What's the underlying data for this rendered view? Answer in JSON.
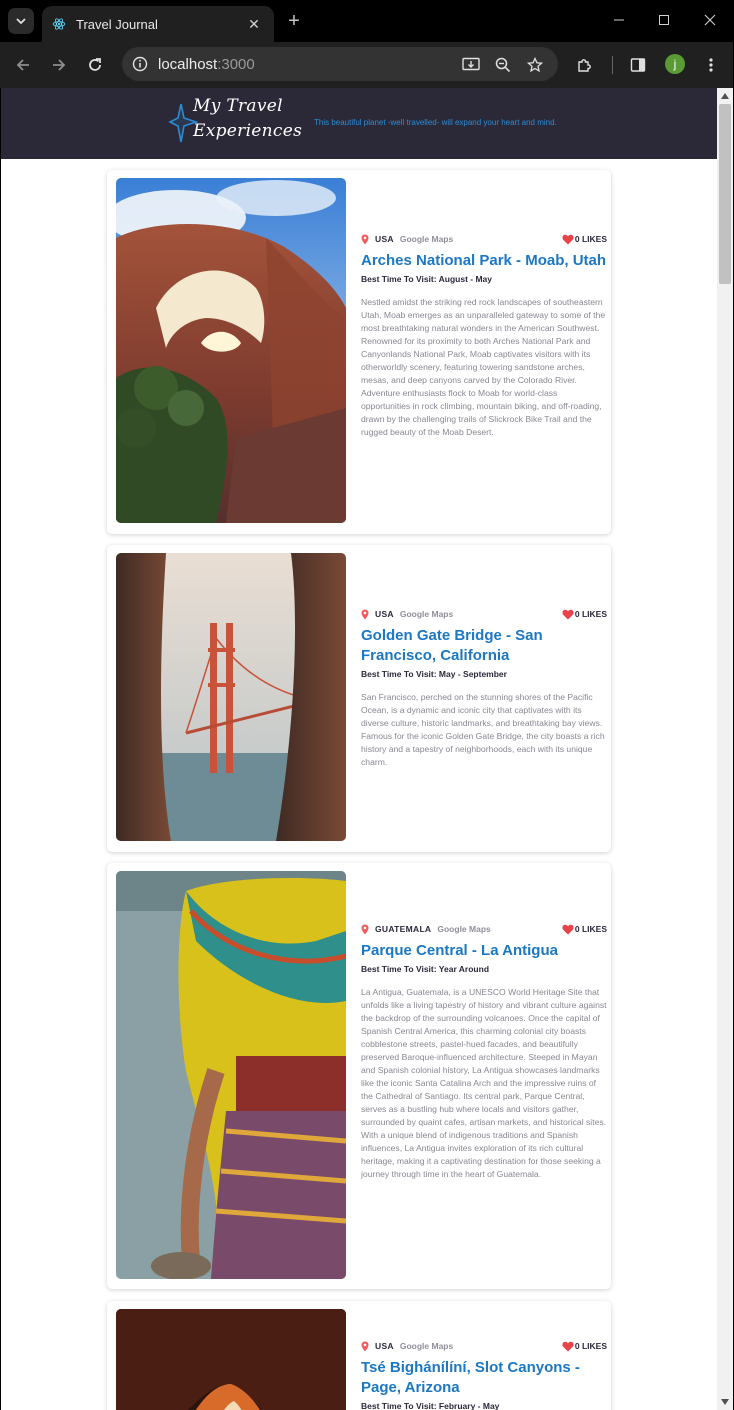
{
  "browser": {
    "tab_title": "Travel Journal",
    "url_host": "localhost",
    "url_port": ":3000",
    "profile_initial": "j"
  },
  "header": {
    "title_line1": "My Travel",
    "title_line2": "Experiences",
    "tagline": "This beautiful planet -well travelled- will expand your heart and mind."
  },
  "cards": [
    {
      "country": "USA",
      "maps_label": "Google Maps",
      "likes": "0 LIKES",
      "title": "Arches National Park - Moab, Utah",
      "best_time": "Best Time To Visit: August - May",
      "description": "Nestled amidst the striking red rock landscapes of southeastern Utah, Moab emerges as an unparalleled gateway to some of the most breathtaking natural wonders in the American Southwest. Renowned for its proximity to both Arches National Park and Canyonlands National Park, Moab captivates visitors with its otherworldly scenery, featuring towering sandstone arches, mesas, and deep canyons carved by the Colorado River. Adventure enthusiasts flock to Moab for world-class opportunities in rock climbing, mountain biking, and off-roading, drawn by the challenging trails of Slickrock Bike Trail and the rugged beauty of the Moab Desert."
    },
    {
      "country": "USA",
      "maps_label": "Google Maps",
      "likes": "0 LIKES",
      "title": "Golden Gate Bridge - San Francisco, California",
      "best_time": "Best Time To Visit: May - September",
      "description": "San Francisco, perched on the stunning shores of the Pacific Ocean, is a dynamic and iconic city that captivates with its diverse culture, historic landmarks, and breathtaking bay views. Famous for the iconic Golden Gate Bridge, the city boasts a rich history and a tapestry of neighborhoods, each with its unique charm."
    },
    {
      "country": "GUATEMALA",
      "maps_label": "Google Maps",
      "likes": "0 LIKES",
      "title": "Parque Central - La Antigua",
      "best_time": "Best Time To Visit: Year Around",
      "description": "La Antigua, Guatemala, is a UNESCO World Heritage Site that unfolds like a living tapestry of history and vibrant culture against the backdrop of the surrounding volcanoes. Once the capital of Spanish Central America, this charming colonial city boasts cobblestone streets, pastel-hued facades, and beautifully preserved Baroque-influenced architecture. Steeped in Mayan and Spanish colonial history, La Antigua showcases landmarks like the iconic Santa Catalina Arch and the impressive ruins of the Cathedral of Santiago. Its central park, Parque Central, serves as a bustling hub where locals and visitors gather, surrounded by quaint cafes, artisan markets, and historical sites. With a unique blend of indigenous traditions and Spanish influences, La Antigua invites exploration of its rich cultural heritage, making it a captivating destination for those seeking a journey through time in the heart of Guatemala."
    },
    {
      "country": "USA",
      "maps_label": "Google Maps",
      "likes": "0 LIKES",
      "title": "Tsé Bighánílíní, Slot Canyons - Page, Arizona",
      "best_time": "Best Time To Visit: February - May",
      "description": ""
    }
  ],
  "colors": {
    "header_bg": "#2b2838",
    "title_blue": "#1c78c2",
    "heart_red": "#e8424a",
    "pin_red": "#f55a5a"
  }
}
